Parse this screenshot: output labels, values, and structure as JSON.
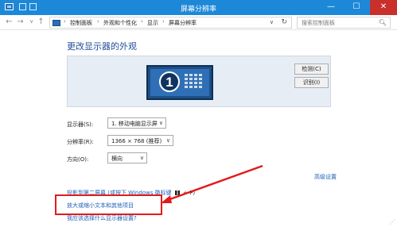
{
  "window": {
    "title": "屏幕分辨率",
    "minimize_glyph": "—",
    "maximize_glyph": "☐",
    "close_glyph": "✕"
  },
  "address_bar": {
    "back_glyph": "←",
    "forward_glyph": "→",
    "up_glyph": "↑",
    "breadcrumbs": [
      "控制面板",
      "外观和个性化",
      "显示",
      "屏幕分辨率"
    ],
    "separator": "›",
    "dropdown_glyph": "∨",
    "refresh_glyph": "↻"
  },
  "search": {
    "placeholder": "搜索控制面板",
    "icon": "search-icon"
  },
  "main": {
    "heading": "更改显示器的外观",
    "monitor_number": "1",
    "detect_button": "检测(C)",
    "identify_button": "识别(I)",
    "display": {
      "label": "显示器(S):",
      "value": "1. 移动电脑显示屏"
    },
    "resolution": {
      "label": "分辨率(R):",
      "value": "1366 × 768 (推荐)"
    },
    "orientation": {
      "label": "方向(O):",
      "value": "横向"
    },
    "advanced_link": "高级设置",
    "project_link": "投影到第二屏幕 (或按下 Windows 徽标键",
    "project_suffix": "+ P)",
    "text_size_link": "放大或缩小文本和其他项目",
    "help_link": "我应该选择什么显示器设置?"
  },
  "colors": {
    "titlebar": "#1e88d8",
    "heading": "#1f4e9a",
    "link": "#2060b8",
    "highlight": "#e21b1b"
  }
}
